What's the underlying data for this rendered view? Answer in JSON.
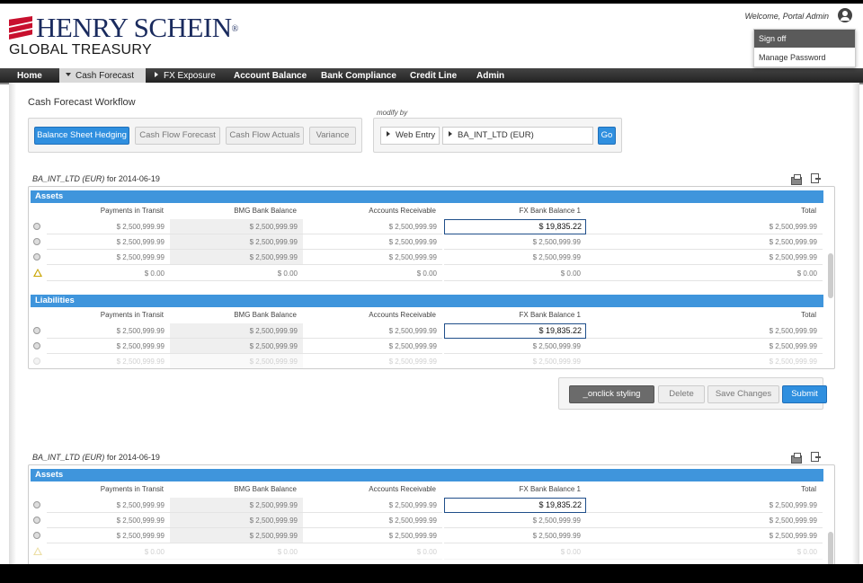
{
  "header": {
    "logo_main": "HENRY SCHEIN",
    "logo_reg": "®",
    "logo_sub": "GLOBAL TREASURY",
    "welcome": "Welcome, Portal Admin",
    "menu": {
      "sign_off": "Sign off",
      "manage_password": "Manage Password"
    }
  },
  "nav": {
    "home": "Home",
    "cash_forecast": "Cash Forecast",
    "fx_exposure": "FX Exposure",
    "account_balance": "Account Balance",
    "bank_compliance": "Bank Compliance",
    "credit_line": "Credit Line",
    "admin": "Admin"
  },
  "workflow": {
    "title": "Cash Forecast Workflow",
    "buttons": {
      "balance_sheet_hedging": "Balance Sheet Hedging",
      "cash_flow_forecast": "Cash Flow Forecast",
      "cash_flow_actuals": "Cash Flow Actuals",
      "variance": "Variance"
    },
    "modify_by": "modify by",
    "entry_select": "Web Entry",
    "entity_select": "BA_INT_LTD (EUR)",
    "go": "Go"
  },
  "section": {
    "entity": "BA_INT_LTD (EUR)",
    "for_date": "for 2014-06-19"
  },
  "columns": {
    "payments": "Payments in Transit",
    "bmg": "BMG Bank Balance",
    "ar": "Accounts Receivable",
    "fx": "FX Bank Balance 1",
    "total": "Total"
  },
  "groups": {
    "assets": "Assets",
    "liabilities": "Liabilities"
  },
  "values": {
    "amount": "$ 2,500,999.99",
    "fx_edit": "$ 19,835.22",
    "zero": "$ 0.00"
  },
  "actions": {
    "onclick": "_onclick styling",
    "delete": "Delete",
    "save": "Save Changes",
    "submit": "Submit"
  },
  "colors": {
    "accent": "#3f95dc",
    "nav": "#333333",
    "warning": "#c9a400"
  },
  "icons": [
    "user-icon",
    "print-icon",
    "export-icon",
    "warning-icon",
    "radio-icon"
  ]
}
